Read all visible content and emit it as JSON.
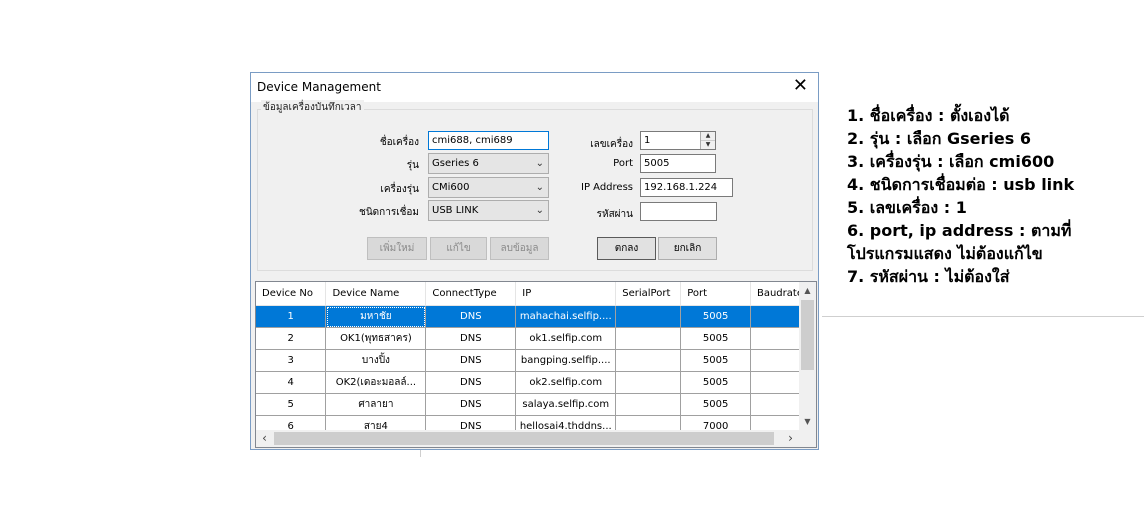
{
  "dialog": {
    "title": "Device Management",
    "close_glyph": "✕",
    "group_label": "ข้อมูลเครื่องบันทึกเวลา",
    "form": {
      "name_label": "ชื่อเครื่อง",
      "name_value": "cmi688, cmi689",
      "model_label": "รุ่น",
      "model_value": "Gseries 6",
      "machine_model_label": "เครื่องรุ่น",
      "machine_model_value": "CMi600",
      "conn_label": "ชนิดการเชื่อม",
      "conn_value": "USB LINK",
      "machine_no_label": "เลขเครื่อง",
      "machine_no_value": "1",
      "port_label": "Port",
      "port_value": "5005",
      "ip_label": "IP Address",
      "ip_value": "192.168.1.224",
      "password_label": "รหัสผ่าน",
      "password_value": ""
    },
    "buttons": {
      "add": "เพิ่มใหม่",
      "edit": "แก้ไข",
      "delete": "ลบข้อมูล",
      "ok": "ตกลง",
      "cancel": "ยกเลิก"
    },
    "table": {
      "columns": [
        "Device No",
        "Device Name",
        "ConnectType",
        "IP",
        "SerialPort",
        "Port",
        "Baudrate"
      ],
      "rows": [
        [
          "1",
          "มหาชัย",
          "DNS",
          "mahachai.selfip....",
          "",
          "5005",
          ""
        ],
        [
          "2",
          "OK1(พุทธสาคร)",
          "DNS",
          "ok1.selfip.com",
          "",
          "5005",
          ""
        ],
        [
          "3",
          "บางปิ้ง",
          "DNS",
          "bangping.selfip....",
          "",
          "5005",
          ""
        ],
        [
          "4",
          "OK2(เดอะมอลล์...",
          "DNS",
          "ok2.selfip.com",
          "",
          "5005",
          ""
        ],
        [
          "5",
          "ศาลายา",
          "DNS",
          "salaya.selfip.com",
          "",
          "5005",
          ""
        ],
        [
          "6",
          "สาย4",
          "DNS",
          "hellosai4.thddns...",
          "",
          "7000",
          ""
        ]
      ],
      "selected_row": 0
    }
  },
  "notes": [
    "1. ชื่อเครื่อง : ตั้งเองได้",
    "2. รุ่น : เลือก Gseries 6",
    "3. เครื่องรุ่น : เลือก cmi600",
    "4. ชนิดการเชื่อมต่อ : usb link",
    "5. เลขเครื่อง : 1",
    "6. port, ip address : ตามที่",
    "โปรแกรมแสดง ไม่ต้องแก้ไข",
    "7. รหัสผ่าน : ไม่ต้องใส่"
  ],
  "colors": {
    "selection": "#0078d7",
    "dialog_bg": "#f0f0f0",
    "border": "#7a9cc4"
  }
}
